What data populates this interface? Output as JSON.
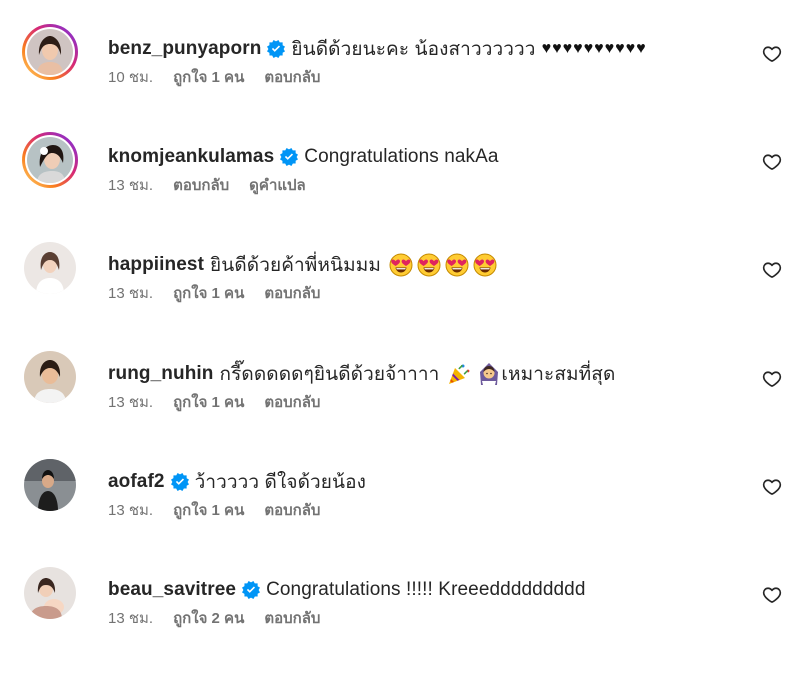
{
  "comments": [
    {
      "username": "benz_punyaporn",
      "verified": true,
      "text": "ยินดีด้วยนะคะ น้องสาวววววว",
      "hearts": "♥♥♥♥♥♥♥♥♥♥",
      "time": "10 ชม.",
      "likes": "ถูกใจ 1 คน",
      "reply": "ตอบกลับ"
    },
    {
      "username": "knomjeankulamas",
      "verified": true,
      "text": "Congratulations nakAa",
      "time": "13 ชม.",
      "reply": "ตอบกลับ",
      "translate": "ดูคำแปล"
    },
    {
      "username": "happiinest",
      "verified": false,
      "text": "ยินดีด้วยค้าพี่หนิมมม",
      "emoji": "heart-eyes-face x4",
      "time": "13 ชม.",
      "likes": "ถูกใจ 1 คน",
      "reply": "ตอบกลับ"
    },
    {
      "username": "rung_nuhin",
      "verified": false,
      "text": "กรี๊ดดดดดๆยินดีด้วยจ้าาาา",
      "text_after": "เหมาะสมที่สุด",
      "emoji": "party-popper, bride-with-veil",
      "time": "13 ชม.",
      "likes": "ถูกใจ 1 คน",
      "reply": "ตอบกลับ"
    },
    {
      "username": "aofaf2",
      "verified": true,
      "text": "ว้าวววว ดีใจด้วยน้อง",
      "time": "13 ชม.",
      "likes": "ถูกใจ 1 คน",
      "reply": "ตอบกลับ"
    },
    {
      "username": "beau_savitree",
      "verified": true,
      "text": "Congratulations !!!!! Kreeeddddddddd",
      "time": "13 ชม.",
      "likes": "ถูกใจ 2 คน",
      "reply": "ตอบกลับ"
    }
  ],
  "icons": {
    "verified": "verified-badge-icon",
    "like": "heart-outline-icon"
  },
  "colors": {
    "verified_blue": "#0095f6",
    "meta_gray": "#737373",
    "text": "#262626"
  }
}
